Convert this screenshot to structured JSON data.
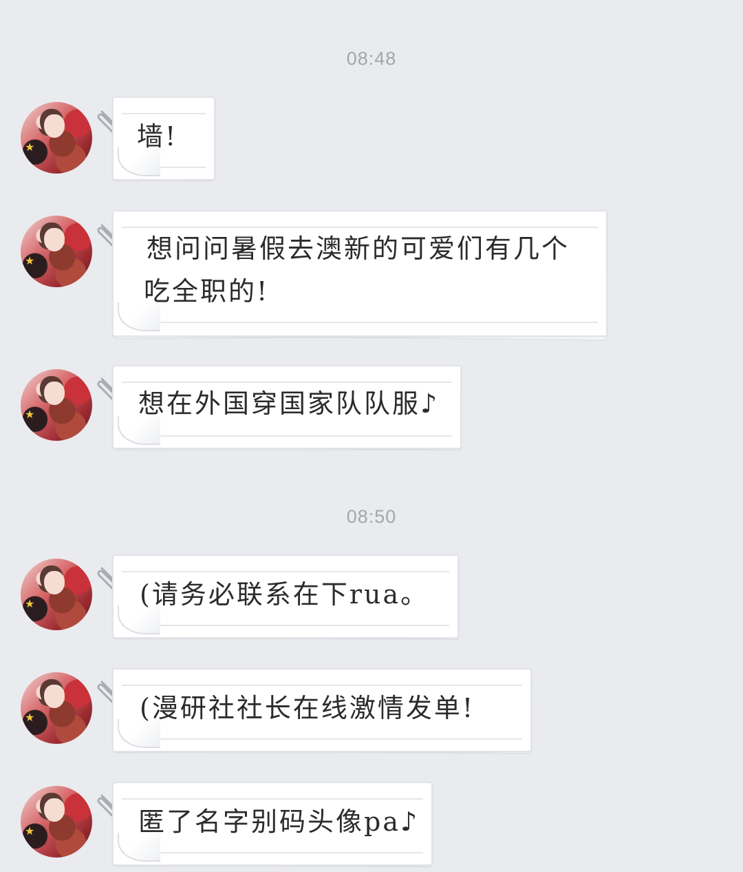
{
  "chat": {
    "timestamps": [
      "08:48",
      "08:50"
    ],
    "messages": [
      {
        "text": "墙!"
      },
      {
        "text_line1": "想问问暑假去澳新的可爱们有几个",
        "text_line2": "吃全职的!"
      },
      {
        "text": "想在外国穿国家队队服♪"
      },
      {
        "text": "(请务必联系在下rua。"
      },
      {
        "text": "(漫研社社长在线激情发单!"
      },
      {
        "text": "匿了名字别码头像pa♪"
      }
    ]
  },
  "icons": {
    "attachment": "paperclip-icon",
    "avatar": "user-avatar"
  },
  "colors": {
    "background": "#eaebef",
    "timestamp": "#a4a6ab",
    "bubble": "#ffffff",
    "text": "#2b2b2b"
  }
}
